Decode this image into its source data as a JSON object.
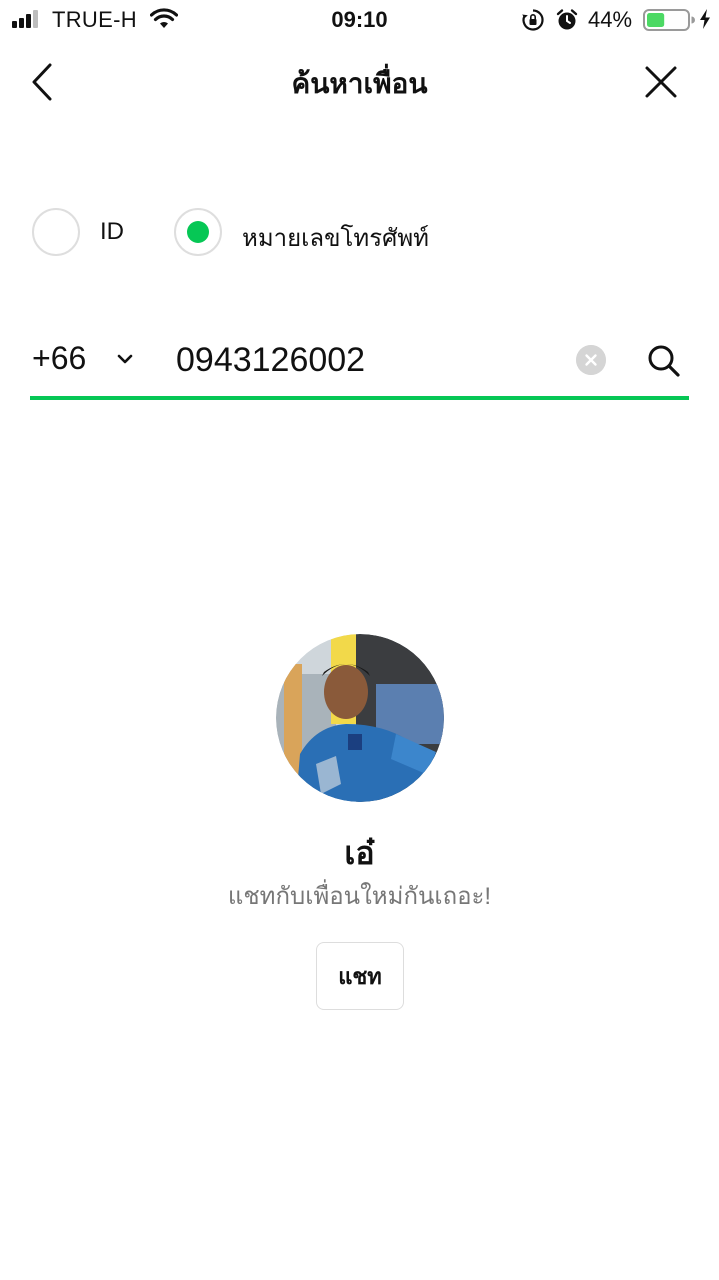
{
  "status_bar": {
    "carrier": "TRUE-H",
    "time": "09:10",
    "battery_percent": "44%",
    "battery_level": 0.44,
    "battery_color": "#4cd964",
    "icons": [
      "signal-icon",
      "wifi-icon",
      "orientation-lock-icon",
      "alarm-icon",
      "battery-icon",
      "charging-bolt-icon"
    ]
  },
  "nav": {
    "title": "ค้นหาเพื่อน",
    "back_icon": "chevron-left-icon",
    "close_icon": "close-icon"
  },
  "search_type": {
    "options": [
      {
        "label": "ID",
        "selected": false
      },
      {
        "label": "หมายเลขโทรศัพท์",
        "selected": true
      }
    ]
  },
  "phone_search": {
    "country_code": "+66",
    "value": "0943126002",
    "clear_icon": "clear-icon",
    "search_icon": "search-icon",
    "accent_color": "#06c755"
  },
  "result": {
    "name": "เอ๋",
    "message": "แชทกับเพื่อนใหม่กันเถอะ!",
    "chat_button": "แชท"
  }
}
